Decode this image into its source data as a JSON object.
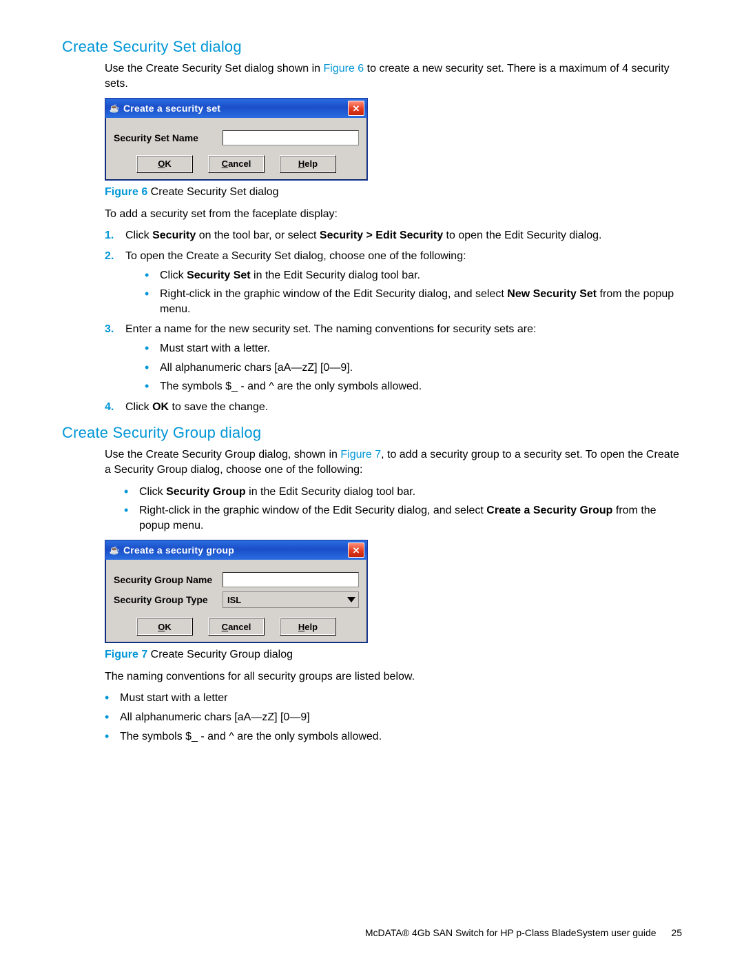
{
  "section1": {
    "heading": "Create Security Set dialog",
    "intro_pre": "Use the Create Security Set dialog shown in ",
    "intro_link": "Figure 6",
    "intro_post": " to create a new security set. There is a maximum of 4 security sets.",
    "dialog": {
      "title": "Create a security set",
      "field_label": "Security Set Name",
      "buttons": {
        "ok": "OK",
        "cancel": "Cancel",
        "help": "Help"
      }
    },
    "figcaption_num": "Figure 6",
    "figcaption_text": " Create Security Set dialog",
    "lead": "To add a security set from the faceplate display:",
    "step1_pre": "Click ",
    "step1_b1": "Security",
    "step1_mid": " on the tool bar, or select ",
    "step1_b2": "Security > Edit Security",
    "step1_post": " to open the Edit Security dialog.",
    "step2": "To open the Create a Security Set dialog, choose one of the following:",
    "step2_b1_pre": "Click ",
    "step2_b1_b": "Security Set",
    "step2_b1_post": " in the Edit Security dialog tool bar.",
    "step2_b2_pre": "Right-click in the graphic window of the Edit Security dialog, and select ",
    "step2_b2_b": "New Security Set",
    "step2_b2_post": " from the popup menu.",
    "step3": "Enter a name for the new security set. The naming conventions for security sets are:",
    "step3_b1": "Must start with a letter.",
    "step3_b2": "All alphanumeric chars [aA—zZ] [0—9].",
    "step3_b3": "The symbols $_ - and ^ are the only symbols allowed.",
    "step4_pre": "Click ",
    "step4_b": "OK",
    "step4_post": " to save the change."
  },
  "section2": {
    "heading": "Create Security Group dialog",
    "intro_pre": "Use the Create Security Group dialog, shown in ",
    "intro_link": "Figure 7",
    "intro_post": ", to add a security group to a security set. To open the Create a Security Group dialog, choose one of the following:",
    "b1_pre": "Click ",
    "b1_b": "Security Group",
    "b1_post": " in the Edit Security dialog tool bar.",
    "b2_pre": "Right-click in the graphic window of the Edit Security dialog, and select ",
    "b2_b": "Create a Security Group",
    "b2_post": " from the popup menu.",
    "dialog": {
      "title": "Create a security group",
      "name_label": "Security Group Name",
      "type_label": "Security Group Type",
      "type_value": "ISL",
      "buttons": {
        "ok": "OK",
        "cancel": "Cancel",
        "help": "Help"
      }
    },
    "figcaption_num": "Figure 7",
    "figcaption_text": " Create Security Group dialog",
    "lead": "The naming conventions for all security groups are listed below.",
    "nb1": "Must start with a letter",
    "nb2": "All alphanumeric chars [aA—zZ] [0—9]",
    "nb3": "The symbols $_ - and ^ are the only symbols allowed."
  },
  "footer": {
    "text": "McDATA® 4Gb SAN Switch for HP p-Class BladeSystem user guide",
    "page": "25"
  }
}
